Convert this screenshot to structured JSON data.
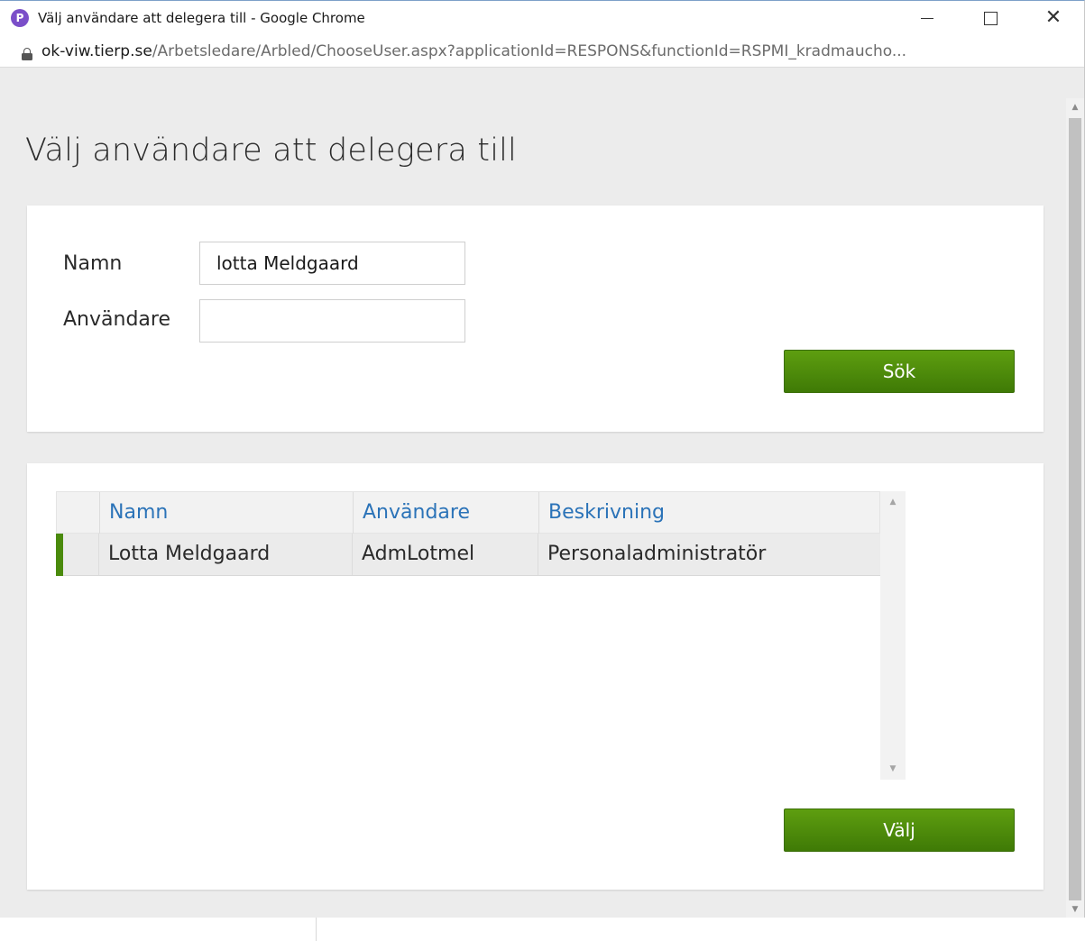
{
  "window": {
    "title": "Välj användare att delegera till - Google Chrome",
    "app_icon_letter": "P",
    "icons": [
      "app-icon",
      "minimize-icon",
      "maximize-icon",
      "close-icon",
      "lock-icon"
    ]
  },
  "address": {
    "host": "ok-viw.tierp.se",
    "path": "/Arbetsledare/Arbled/ChooseUser.aspx?applicationId=RESPONS&functionId=RSPMI_kradmaucho..."
  },
  "page": {
    "heading": "Välj användare att delegera till"
  },
  "search": {
    "name_label": "Namn",
    "name_value": "lotta Meldgaard",
    "user_label": "Användare",
    "user_value": "",
    "search_button": "Sök"
  },
  "grid": {
    "columns": [
      "Namn",
      "Användare",
      "Beskrivning"
    ],
    "rows": [
      {
        "namn": "Lotta Meldgaard",
        "anvandare": "AdmLotmel",
        "beskrivning": "Personaladministratör"
      }
    ]
  },
  "actions": {
    "select_button": "Välj"
  },
  "colors": {
    "accent_green": "#4a8a0c",
    "header_blue": "#2b73b8",
    "page_background": "#ececec"
  }
}
